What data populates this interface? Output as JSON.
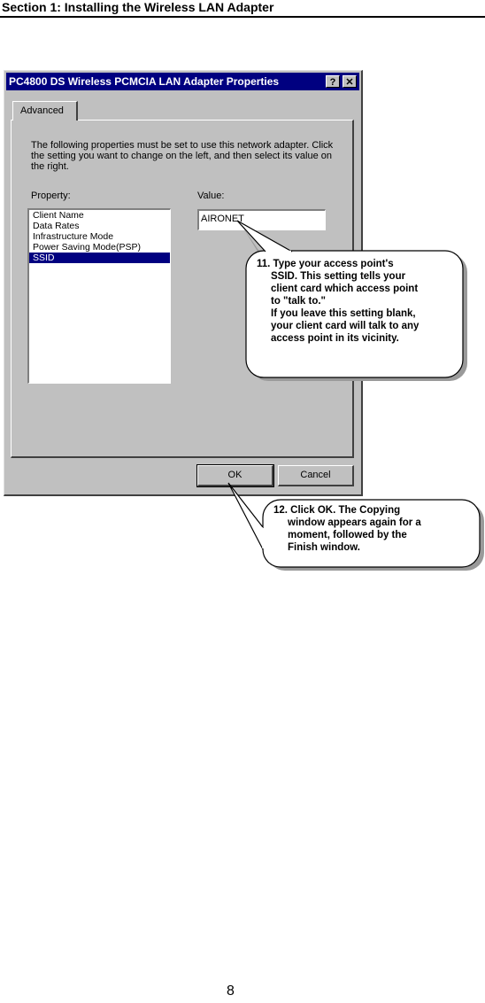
{
  "section_header": "Section 1: Installing the Wireless LAN Adapter",
  "dialog": {
    "title": "PC4800 DS Wireless PCMCIA LAN Adapter Properties",
    "help_label": "?",
    "close_label": "✕",
    "tab_label": "Advanced",
    "description": "The following properties must be set to use this network adapter. Click the setting you want to change on the left, and then select its value on the right.",
    "property_label": "Property:",
    "value_label": "Value:",
    "properties": [
      "Client Name",
      "Data Rates",
      "Infrastructure Mode",
      "Power Saving Mode(PSP)",
      "SSID"
    ],
    "selected_property": "SSID",
    "value": "AIRONET",
    "ok_label": "OK",
    "cancel_label": "Cancel"
  },
  "callout1": {
    "line1": "11.  Type your access point's",
    "line2": "SSID. This setting tells your",
    "line3": "client card which access point",
    "line4": "to \"talk to.\"",
    "line5": "If you leave this setting blank,",
    "line6": "your client card will talk to any",
    "line7": "access point in its vicinity."
  },
  "callout2": {
    "line1": "12. Click OK. The Copying",
    "line2": "window appears again for a",
    "line3": "moment, followed by the",
    "line4": "Finish window."
  },
  "page_number": "8"
}
